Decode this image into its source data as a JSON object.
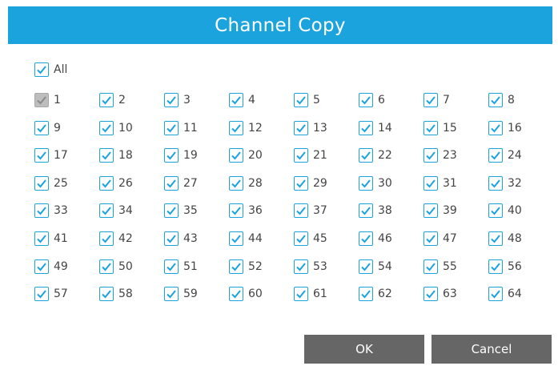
{
  "dialog": {
    "title": "Channel Copy",
    "all": {
      "label": "All",
      "checked": true
    },
    "channels": [
      {
        "label": "1",
        "checked": true,
        "disabled": true
      },
      {
        "label": "2",
        "checked": true
      },
      {
        "label": "3",
        "checked": true
      },
      {
        "label": "4",
        "checked": true
      },
      {
        "label": "5",
        "checked": true
      },
      {
        "label": "6",
        "checked": true
      },
      {
        "label": "7",
        "checked": true
      },
      {
        "label": "8",
        "checked": true
      },
      {
        "label": "9",
        "checked": true
      },
      {
        "label": "10",
        "checked": true
      },
      {
        "label": "11",
        "checked": true
      },
      {
        "label": "12",
        "checked": true
      },
      {
        "label": "13",
        "checked": true
      },
      {
        "label": "14",
        "checked": true
      },
      {
        "label": "15",
        "checked": true
      },
      {
        "label": "16",
        "checked": true
      },
      {
        "label": "17",
        "checked": true
      },
      {
        "label": "18",
        "checked": true
      },
      {
        "label": "19",
        "checked": true
      },
      {
        "label": "20",
        "checked": true
      },
      {
        "label": "21",
        "checked": true
      },
      {
        "label": "22",
        "checked": true
      },
      {
        "label": "23",
        "checked": true
      },
      {
        "label": "24",
        "checked": true
      },
      {
        "label": "25",
        "checked": true
      },
      {
        "label": "26",
        "checked": true
      },
      {
        "label": "27",
        "checked": true
      },
      {
        "label": "28",
        "checked": true
      },
      {
        "label": "29",
        "checked": true
      },
      {
        "label": "30",
        "checked": true
      },
      {
        "label": "31",
        "checked": true
      },
      {
        "label": "32",
        "checked": true
      },
      {
        "label": "33",
        "checked": true
      },
      {
        "label": "34",
        "checked": true
      },
      {
        "label": "35",
        "checked": true
      },
      {
        "label": "36",
        "checked": true
      },
      {
        "label": "37",
        "checked": true
      },
      {
        "label": "38",
        "checked": true
      },
      {
        "label": "39",
        "checked": true
      },
      {
        "label": "40",
        "checked": true
      },
      {
        "label": "41",
        "checked": true
      },
      {
        "label": "42",
        "checked": true
      },
      {
        "label": "43",
        "checked": true
      },
      {
        "label": "44",
        "checked": true
      },
      {
        "label": "45",
        "checked": true
      },
      {
        "label": "46",
        "checked": true
      },
      {
        "label": "47",
        "checked": true
      },
      {
        "label": "48",
        "checked": true
      },
      {
        "label": "49",
        "checked": true
      },
      {
        "label": "50",
        "checked": true
      },
      {
        "label": "51",
        "checked": true
      },
      {
        "label": "52",
        "checked": true
      },
      {
        "label": "53",
        "checked": true
      },
      {
        "label": "54",
        "checked": true
      },
      {
        "label": "55",
        "checked": true
      },
      {
        "label": "56",
        "checked": true
      },
      {
        "label": "57",
        "checked": true
      },
      {
        "label": "58",
        "checked": true
      },
      {
        "label": "59",
        "checked": true
      },
      {
        "label": "60",
        "checked": true
      },
      {
        "label": "61",
        "checked": true
      },
      {
        "label": "62",
        "checked": true
      },
      {
        "label": "63",
        "checked": true
      },
      {
        "label": "64",
        "checked": true
      }
    ],
    "ok_label": "OK",
    "cancel_label": "Cancel"
  },
  "colors": {
    "accent": "#1ba3dd",
    "button": "#666666",
    "disabled_box": "#bdbdbd"
  },
  "icons": {
    "checkbox": "checkmark-icon"
  }
}
